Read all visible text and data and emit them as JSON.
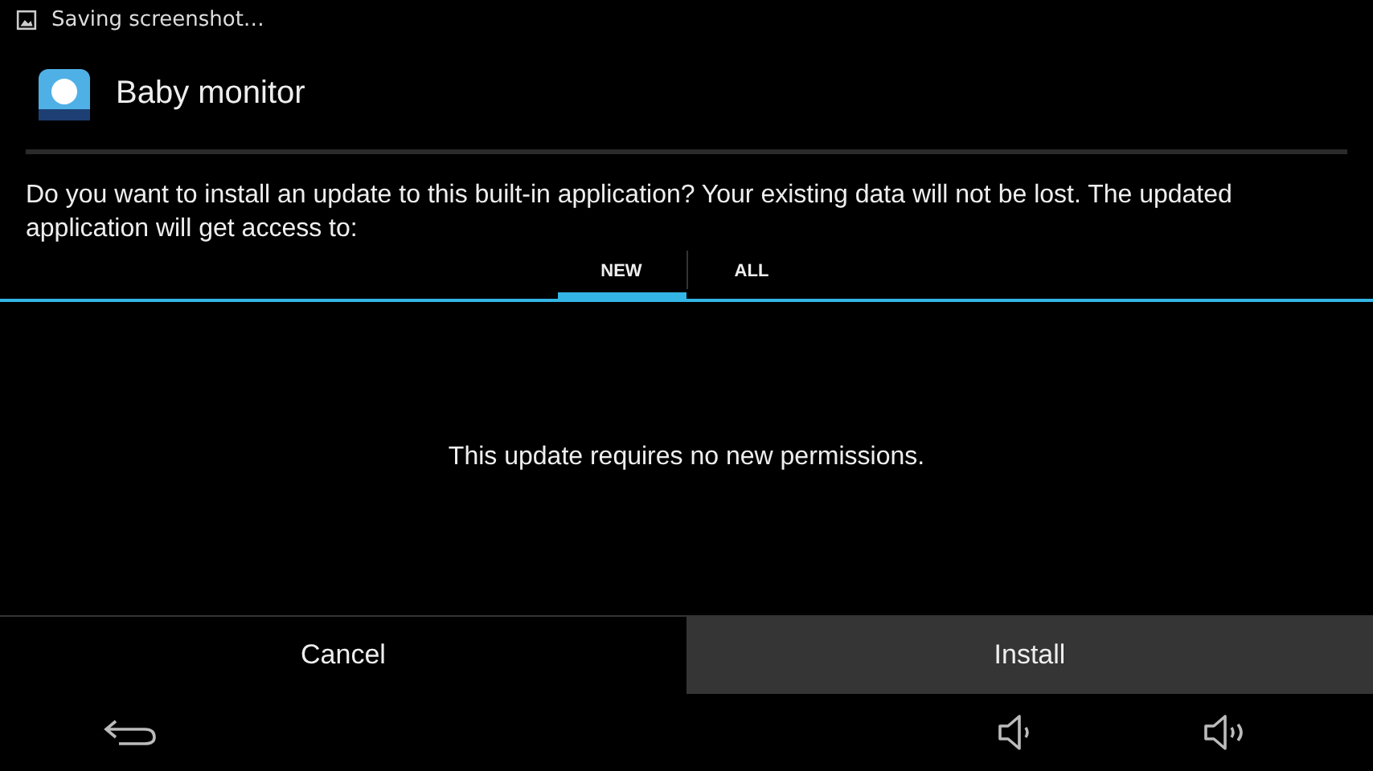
{
  "status_bar": {
    "notification": "Saving screenshot…"
  },
  "dialog": {
    "title": "Baby monitor",
    "message": "Do you want to install an update to this built-in application? Your existing data will not be lost. The updated application will get access to:",
    "tabs": [
      {
        "label": "NEW",
        "selected": true
      },
      {
        "label": "ALL",
        "selected": false
      }
    ],
    "content": "This update requires no new permissions.",
    "buttons": [
      {
        "label": "Cancel",
        "highlighted": false
      },
      {
        "label": "Install",
        "highlighted": true
      }
    ]
  }
}
